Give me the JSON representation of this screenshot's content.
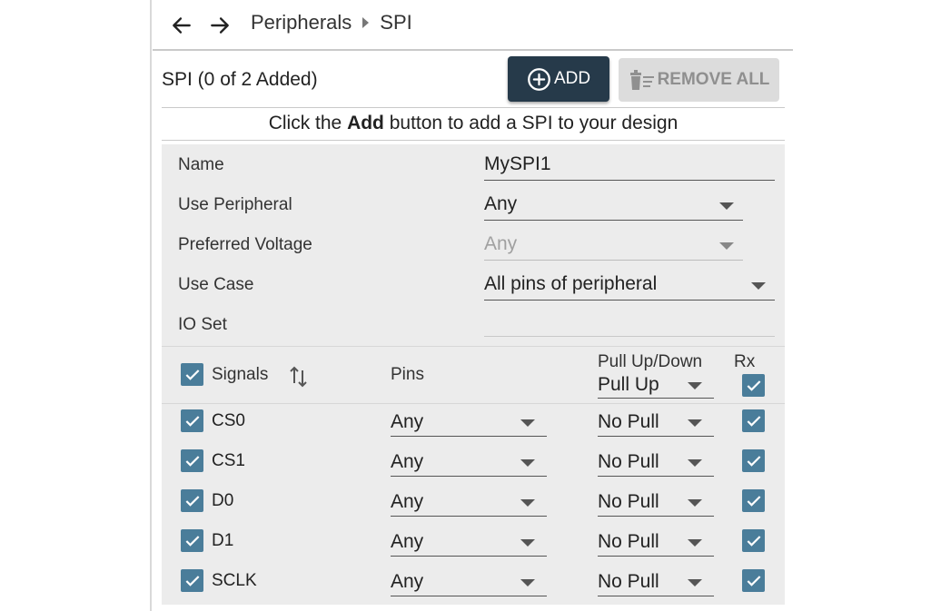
{
  "nav": {
    "back_icon": "arrow-left-icon",
    "forward_icon": "arrow-right-icon",
    "breadcrumb": [
      "Peripherals",
      "SPI"
    ]
  },
  "header": {
    "title": "SPI (0 of 2 Added)",
    "add_label": "ADD",
    "add_icon": "plus-circle-icon",
    "remove_label": "REMOVE ALL",
    "remove_icon": "trash-list-icon"
  },
  "hint": {
    "prefix": "Click the ",
    "bold": "Add",
    "suffix": " button to add a SPI to your design"
  },
  "form": {
    "name": {
      "label": "Name",
      "value": "MySPI1"
    },
    "use_peripheral": {
      "label": "Use Peripheral",
      "value": "Any"
    },
    "preferred_voltage": {
      "label": "Preferred Voltage",
      "value": "Any"
    },
    "use_case": {
      "label": "Use Case",
      "value": "All pins of peripheral"
    },
    "io_set": {
      "label": "IO Set",
      "value": ""
    }
  },
  "signals": {
    "header": {
      "signals_label": "Signals",
      "sort_icon": "sort-arrows-icon",
      "pins_label": "Pins",
      "pull_label": "Pull Up/Down",
      "pull_value": "Pull Up",
      "rx_label": "Rx"
    },
    "rows": [
      {
        "name": "CS0",
        "pin": "Any",
        "pull": "No Pull"
      },
      {
        "name": "CS1",
        "pin": "Any",
        "pull": "No Pull"
      },
      {
        "name": "D0",
        "pin": "Any",
        "pull": "No Pull"
      },
      {
        "name": "D1",
        "pin": "Any",
        "pull": "No Pull"
      },
      {
        "name": "SCLK",
        "pin": "Any",
        "pull": "No Pull"
      }
    ]
  },
  "colors": {
    "add_button": "#263a4a",
    "checkbox": "#4a7d9a",
    "panel_bg": "#ececec"
  }
}
